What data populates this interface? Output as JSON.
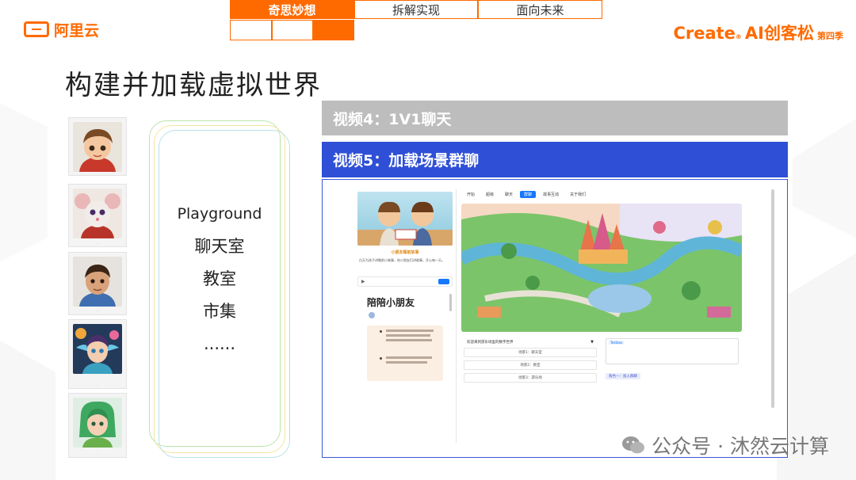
{
  "header": {
    "logo_text": "阿里云",
    "nav_tabs": [
      "奇思妙想",
      "拆解实现",
      "面向未来"
    ],
    "event_logo": {
      "create": "Create",
      "reg": "®",
      "brand": "AI创客松",
      "season": "第四季"
    }
  },
  "page_title": "构建并加载虚拟世界",
  "playground": {
    "items": [
      "Playground",
      "聊天室",
      "教室",
      "市集",
      "......"
    ]
  },
  "videos": {
    "video4_label": "视频4：1V1聊天",
    "video5_label": "视频5：加载场景群聊"
  },
  "demo": {
    "banner_title": "小朋友睡前故事",
    "intro_text": "白天为孩子讲睡前小故事，给小朋友们讲故事，开心每一天。",
    "chat_title": "陪陪小朋友",
    "tabs": [
      "开始",
      "超级",
      "聊天",
      "群聊",
      "故事互动",
      "关于我们"
    ],
    "active_tab": "群聊",
    "select_value": "欢迎来到游乐场里的数字世界",
    "options": [
      "场景1：聊天室",
      "场景2：教室",
      "场景3：游乐场"
    ],
    "textbox_label": "Textbox",
    "chip_text": "角色一：加入群聊"
  },
  "watermark": "公众号 · 沐然云计算",
  "colors": {
    "brand": "#ff6a00",
    "video4_bar": "#bdbdbd",
    "video5_bar": "#2e4fd6",
    "tab_active": "#1677ff"
  }
}
